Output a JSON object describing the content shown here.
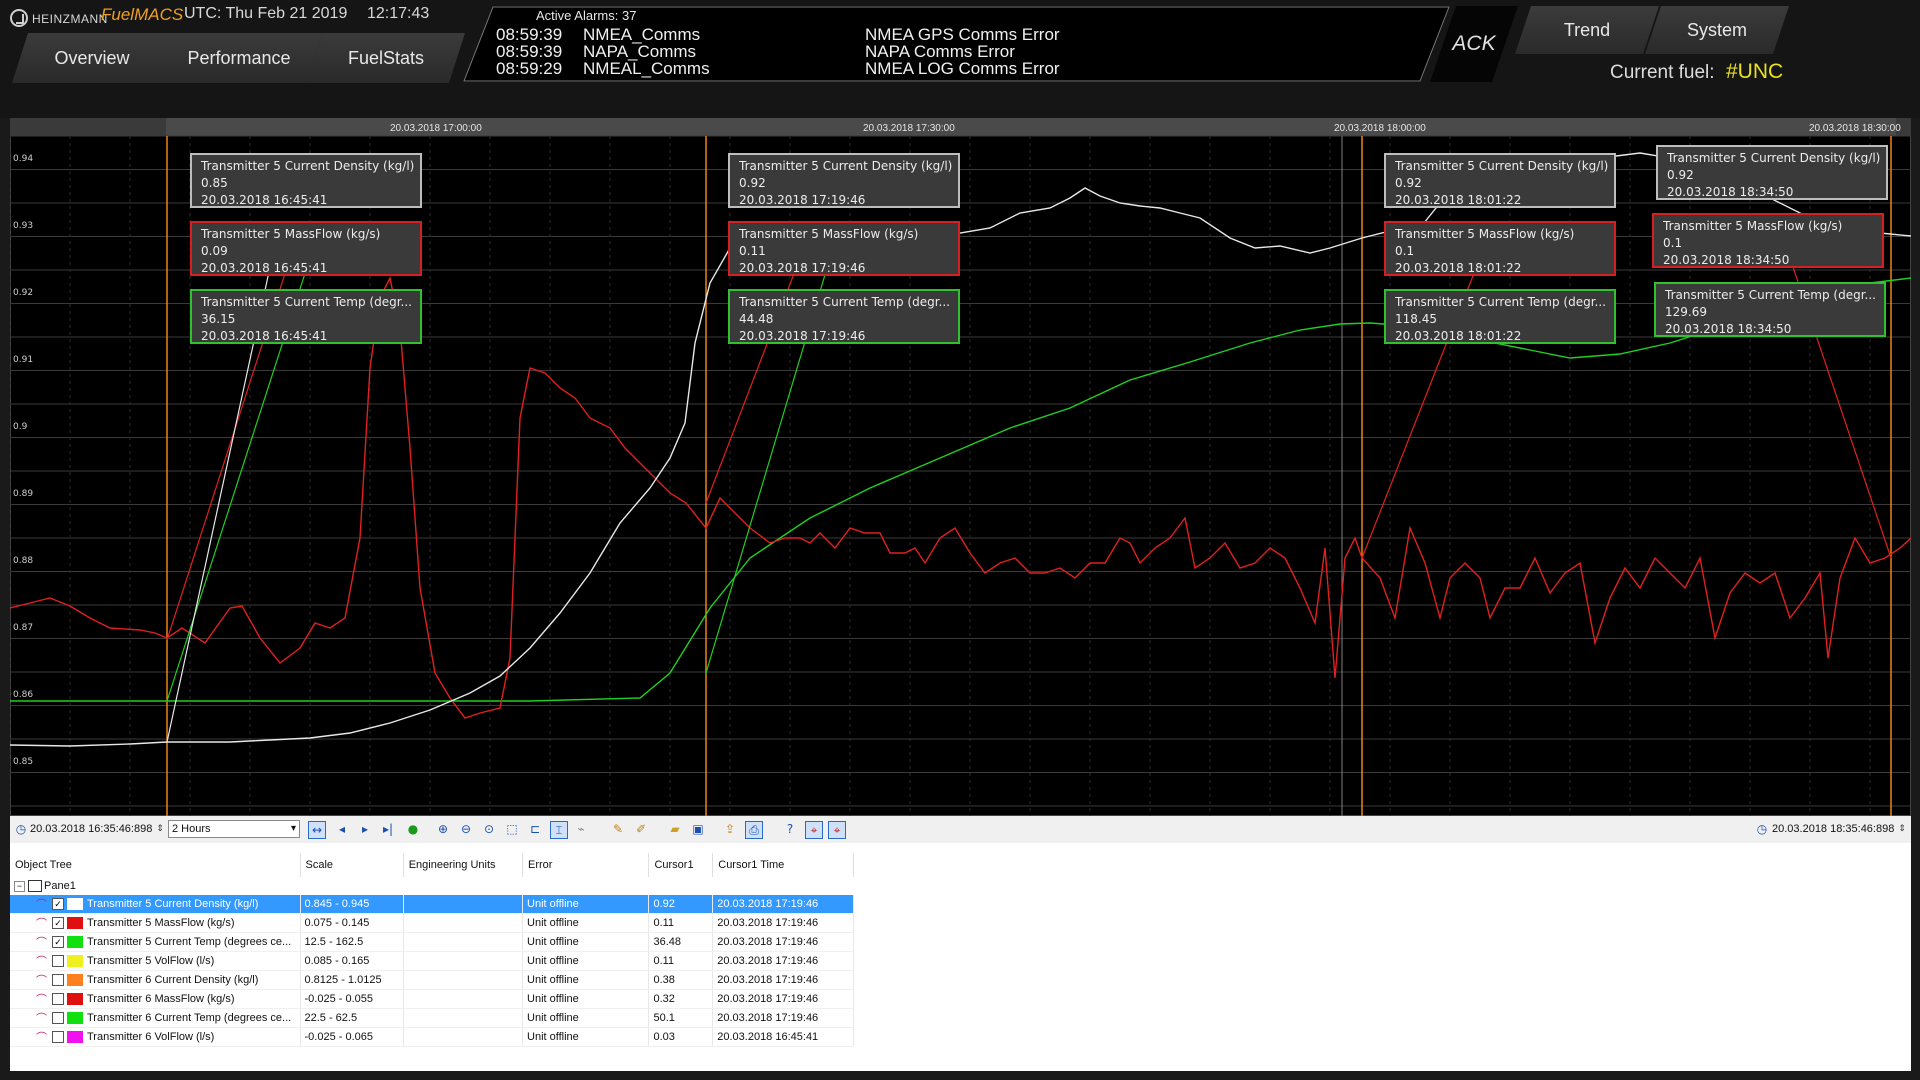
{
  "header": {
    "brand": "HEINZMANN",
    "app_name": "FuelMACS",
    "utc_date": "UTC: Thu Feb 21 2019",
    "utc_time": "12:17:43",
    "nav_tabs": [
      "Overview",
      "Performance",
      "FuelStats"
    ],
    "alarms": {
      "title": "Active Alarms: 37",
      "rows": [
        {
          "time": "08:59:39",
          "source": "NMEA_Comms",
          "message": "NMEA GPS Comms Error"
        },
        {
          "time": "08:59:39",
          "source": "NAPA_Comms",
          "message": "NAPA Comms Error"
        },
        {
          "time": "08:59:29",
          "source": "NMEAL_Comms",
          "message": "NMEA LOG Comms Error"
        }
      ]
    },
    "ack_label": "ACK",
    "right_tabs": [
      "Trend",
      "System"
    ],
    "current_fuel_label": "Current fuel:",
    "current_fuel_value": "#UNC",
    "accent_color": "#f0a020",
    "fuel_value_color": "#e8e020"
  },
  "chart": {
    "time_labels": [
      "20.03.2018 17:00:00",
      "20.03.2018 17:30:00",
      "20.03.2018 18:00:00",
      "20.03.2018 18:30:00"
    ],
    "y_labels": [
      "0.94",
      "0.93",
      "0.92",
      "0.91",
      "0.9",
      "0.89",
      "0.88",
      "0.87",
      "0.86",
      "0.85"
    ],
    "tooltips": [
      [
        {
          "title": "Transmitter 5 Current Density (kg/l)",
          "value": "0.85",
          "time": "20.03.2018 16:45:41",
          "color": "white"
        },
        {
          "title": "Transmitter 5 MassFlow (kg/s)",
          "value": "0.09",
          "time": "20.03.2018 16:45:41",
          "color": "red"
        },
        {
          "title": "Transmitter 5 Current Temp (degr...",
          "value": "36.15",
          "time": "20.03.2018 16:45:41",
          "color": "green"
        }
      ],
      [
        {
          "title": "Transmitter 5 Current Density (kg/l)",
          "value": "0.92",
          "time": "20.03.2018 17:19:46",
          "color": "white"
        },
        {
          "title": "Transmitter 5 MassFlow (kg/s)",
          "value": "0.11",
          "time": "20.03.2018 17:19:46",
          "color": "red"
        },
        {
          "title": "Transmitter 5 Current Temp (degr...",
          "value": "44.48",
          "time": "20.03.2018 17:19:46",
          "color": "green"
        }
      ],
      [
        {
          "title": "Transmitter 5 Current Density (kg/l)",
          "value": "0.92",
          "time": "20.03.2018 18:01:22",
          "color": "white"
        },
        {
          "title": "Transmitter 5 MassFlow (kg/s)",
          "value": "0.1",
          "time": "20.03.2018 18:01:22",
          "color": "red"
        },
        {
          "title": "Transmitter 5 Current Temp (degr...",
          "value": "118.45",
          "time": "20.03.2018 18:01:22",
          "color": "green"
        }
      ],
      [
        {
          "title": "Transmitter 5 Current Density (kg/l)",
          "value": "0.92",
          "time": "20.03.2018 18:34:50",
          "color": "white"
        },
        {
          "title": "Transmitter 5 MassFlow (kg/s)",
          "value": "0.1",
          "time": "20.03.2018 18:34:50",
          "color": "red"
        },
        {
          "title": "Transmitter 5 Current Temp (degr...",
          "value": "129.69",
          "time": "20.03.2018 18:34:50",
          "color": "green"
        }
      ]
    ],
    "series_colors": {
      "density": "#e8e8e8",
      "massflow": "#e02020",
      "temp": "#20d020",
      "cursor": "#ff8c1a"
    }
  },
  "toolbar": {
    "start_time": "20.03.2018 16:35:46:898",
    "range": "2 Hours",
    "end_time": "20.03.2018 18:35:46:898",
    "icons": [
      "fit-icon",
      "prev-icon",
      "play-icon",
      "next-icon",
      "record-icon",
      "zoom-in-icon",
      "zoom-out-icon",
      "zoom-reset-icon",
      "zoom-box-icon",
      "cursor-icon",
      "cursor-link-icon",
      "pen-icon",
      "pen-alt-icon",
      "open-icon",
      "save-icon",
      "export-icon",
      "print-icon",
      "help-icon",
      "cursor-mode-1-icon",
      "cursor-mode-2-icon"
    ]
  },
  "table": {
    "columns": [
      "Object Tree",
      "Scale",
      "Engineering Units",
      "Error",
      "Cursor1",
      "Cursor1 Time"
    ],
    "pane_label": "Pane1",
    "rows": [
      {
        "name": "Transmitter 5 Current Density (kg/l)",
        "scale": "0.845 - 0.945",
        "units": "",
        "error": "Unit offline",
        "cursor": "0.92",
        "cursor_time": "20.03.2018 17:19:46",
        "color": "#ffffff",
        "checked": true,
        "selected": true
      },
      {
        "name": "Transmitter 5 MassFlow (kg/s)",
        "scale": "0.075 - 0.145",
        "units": "",
        "error": "Unit offline",
        "cursor": "0.11",
        "cursor_time": "20.03.2018 17:19:46",
        "color": "#e01010",
        "checked": true,
        "selected": false
      },
      {
        "name": "Transmitter 5 Current Temp (degrees ce...",
        "scale": "12.5 - 162.5",
        "units": "",
        "error": "Unit offline",
        "cursor": "36.48",
        "cursor_time": "20.03.2018 17:19:46",
        "color": "#10e010",
        "checked": true,
        "selected": false
      },
      {
        "name": "Transmitter 5 VolFlow (l/s)",
        "scale": "0.085 - 0.165",
        "units": "",
        "error": "Unit offline",
        "cursor": "0.11",
        "cursor_time": "20.03.2018 17:19:46",
        "color": "#f0f020",
        "checked": false,
        "selected": false
      },
      {
        "name": "Transmitter 6 Current Density (kg/l)",
        "scale": "0.8125 - 1.0125",
        "units": "",
        "error": "Unit offline",
        "cursor": "0.38",
        "cursor_time": "20.03.2018 17:19:46",
        "color": "#ff8020",
        "checked": false,
        "selected": false
      },
      {
        "name": "Transmitter 6 MassFlow (kg/s)",
        "scale": "-0.025 - 0.055",
        "units": "",
        "error": "Unit offline",
        "cursor": "0.32",
        "cursor_time": "20.03.2018 17:19:46",
        "color": "#e01010",
        "checked": false,
        "selected": false
      },
      {
        "name": "Transmitter 6 Current Temp (degrees ce...",
        "scale": "22.5 - 62.5",
        "units": "",
        "error": "Unit offline",
        "cursor": "50.1",
        "cursor_time": "20.03.2018 17:19:46",
        "color": "#10e010",
        "checked": false,
        "selected": false
      },
      {
        "name": "Transmitter 6 VolFlow (l/s)",
        "scale": "-0.025 - 0.065",
        "units": "",
        "error": "Unit offline",
        "cursor": "0.03",
        "cursor_time": "20.03.2018 16:45:41",
        "color": "#f010f0",
        "checked": false,
        "selected": false
      }
    ]
  }
}
